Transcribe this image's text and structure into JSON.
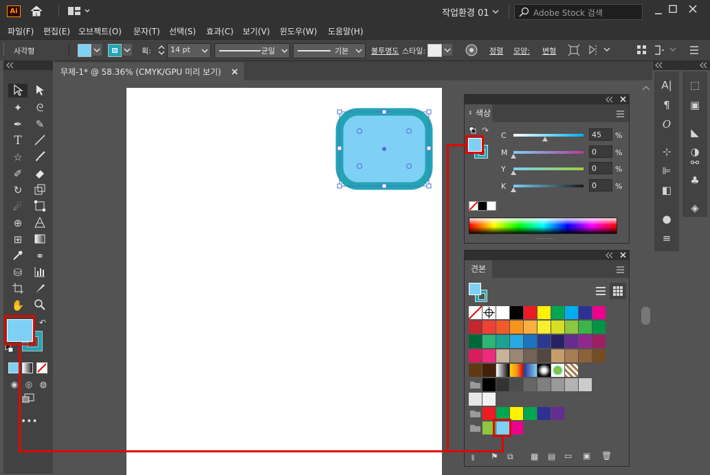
{
  "app": {
    "logo": "Ai",
    "workspace": "작업환경 01",
    "search_placeholder": "Adobe Stock 검색"
  },
  "menu": [
    "파일(F)",
    "편집(E)",
    "오브젝트(O)",
    "문자(T)",
    "선택(S)",
    "효과(C)",
    "보기(V)",
    "윈도우(W)",
    "도움말(H)"
  ],
  "control": {
    "object_type": "사각형",
    "stroke_label": "획:",
    "stroke_weight": "14 pt",
    "stroke_profile": "균일",
    "brush": "기본",
    "opacity_label": "불투명도",
    "style_label": "스타일:",
    "align_label": "정렬",
    "shape_label": "모양:",
    "transform_label": "변형"
  },
  "document": {
    "tab_title": "무제-1* @ 58.36% (CMYK/GPU 미리 보기)"
  },
  "color_panel": {
    "title": "색상",
    "sliders": [
      {
        "label": "C",
        "value": "45",
        "pct": "%"
      },
      {
        "label": "M",
        "value": "0",
        "pct": "%"
      },
      {
        "label": "Y",
        "value": "0",
        "pct": "%"
      },
      {
        "label": "K",
        "value": "0",
        "pct": "%"
      }
    ]
  },
  "swatches_panel": {
    "title": "견본"
  },
  "colors": {
    "fill": "#7fd0f5",
    "stroke": "#22a5b3",
    "highlight": "#e10600"
  },
  "icons": [
    "home-icon",
    "arrange-icon",
    "search-icon",
    "minimize-icon",
    "maximize-icon",
    "close-icon",
    "selection-tool-icon",
    "direct-selection-tool-icon",
    "magic-wand-icon",
    "lasso-icon",
    "pen-icon",
    "curvature-icon",
    "type-icon",
    "line-icon",
    "star-icon",
    "paintbrush-icon",
    "shaper-icon",
    "eraser-icon",
    "rotate-icon",
    "scale-icon",
    "warp-icon",
    "free-transform-icon",
    "shape-builder-icon",
    "perspective-icon",
    "mesh-icon",
    "gradient-icon",
    "eyedropper-icon",
    "blend-icon",
    "symbol-sprayer-icon",
    "graph-icon",
    "artboard-icon",
    "slice-icon",
    "hand-icon",
    "zoom-icon",
    "swap-icon",
    "default-colors-icon",
    "more-tools-icon",
    "character-icon",
    "paragraph-icon",
    "opentype-icon",
    "transform-icon",
    "align-icon",
    "pathfinder-icon",
    "appearance-icon",
    "stroke-icon",
    "gradient-panel-icon",
    "transparency-icon",
    "links-icon",
    "symbols-icon",
    "layers-icon",
    "graphic-styles-icon",
    "brush-library-icon",
    "recolor-icon"
  ]
}
